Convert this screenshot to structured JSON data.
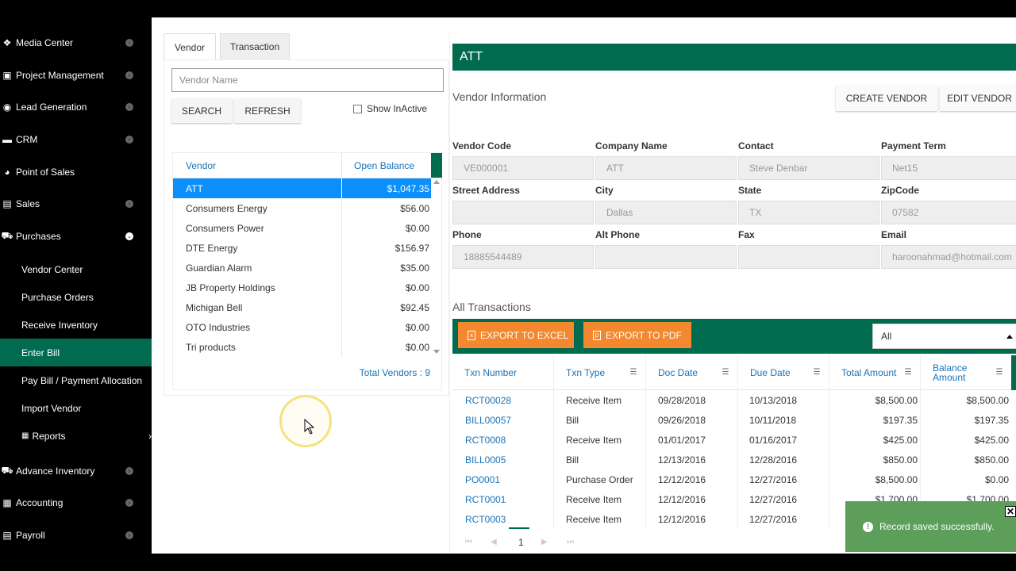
{
  "sidebar": {
    "items": [
      {
        "label": "Media Center",
        "icon": "cubes-icon"
      },
      {
        "label": "Project Management",
        "icon": "briefcase-icon"
      },
      {
        "label": "Lead Generation",
        "icon": "target-icon"
      },
      {
        "label": "CRM",
        "icon": "folder-icon"
      },
      {
        "label": "Point of Sales",
        "icon": "tachometer-icon"
      },
      {
        "label": "Sales",
        "icon": "money-icon"
      },
      {
        "label": "Purchases",
        "icon": "cart-icon"
      }
    ],
    "purchases_sub": [
      {
        "label": "Vendor Center"
      },
      {
        "label": "Purchase Orders"
      },
      {
        "label": "Receive Inventory"
      },
      {
        "label": "Enter Bill"
      },
      {
        "label": "Pay Bill / Payment Allocation"
      },
      {
        "label": "Import Vendor"
      },
      {
        "label": "Reports"
      }
    ],
    "bottom_items": [
      {
        "label": "Advance Inventory",
        "icon": "cart-icon"
      },
      {
        "label": "Accounting",
        "icon": "calculator-icon"
      },
      {
        "label": "Payroll",
        "icon": "money-icon"
      }
    ]
  },
  "left": {
    "tabs": [
      "Vendor",
      "Transaction"
    ],
    "search_placeholder": "Vendor Name",
    "search_label": "SEARCH",
    "refresh_label": "REFRESH",
    "show_inactive_label": "Show InActive",
    "grid": {
      "headers": [
        "Vendor",
        "Open Balance"
      ],
      "rows": [
        {
          "name": "ATT",
          "balance": "$1,047.35"
        },
        {
          "name": "Consumers Energy",
          "balance": "$56.00"
        },
        {
          "name": "Consumers Power",
          "balance": "$0.00"
        },
        {
          "name": "DTE Energy",
          "balance": "$156.97"
        },
        {
          "name": "Guardian Alarm",
          "balance": "$35.00"
        },
        {
          "name": "JB Property Holdings",
          "balance": "$0.00"
        },
        {
          "name": "Michigan Bell",
          "balance": "$92.45"
        },
        {
          "name": "OTO Industries",
          "balance": "$0.00"
        },
        {
          "name": "Tri products",
          "balance": "$0.00"
        }
      ],
      "total_label": "Total Vendors : 9"
    }
  },
  "right": {
    "title": "ATT",
    "vendor_info_label": "Vendor Information",
    "create_vendor_label": "CREATE VENDOR",
    "edit_vendor_label": "EDIT VENDOR",
    "fields": {
      "vendor_code_label": "Vendor Code",
      "vendor_code": "VE000001",
      "company_name_label": "Company Name",
      "company_name": "ATT",
      "contact_label": "Contact",
      "contact": "Steve Denbar",
      "payment_term_label": "Payment Term",
      "payment_term": "Net15",
      "street_label": "Street Address",
      "street": "",
      "city_label": "City",
      "city": "Dallas",
      "state_label": "State",
      "state": "TX",
      "zip_label": "ZipCode",
      "zip": "07582",
      "phone_label": "Phone",
      "phone": "18885544489",
      "alt_phone_label": "Alt Phone",
      "alt_phone": "",
      "fax_label": "Fax",
      "fax": "",
      "email_label": "Email",
      "email": "haroonahmad@hotmail.com"
    },
    "all_transactions_label": "All Transactions",
    "export_excel_label": "EXPORT TO EXCEL",
    "export_pdf_label": "EXPORT TO PDF",
    "filter_value": "All",
    "table": {
      "headers": [
        "Txn Number",
        "Txn Type",
        "Doc Date",
        "Due Date",
        "Total Amount",
        "Balance Amount"
      ],
      "rows": [
        [
          "RCT00028",
          "Receive Item",
          "09/28/2018",
          "10/13/2018",
          "$8,500.00",
          "$8,500.00"
        ],
        [
          "BILL00057",
          "Bill",
          "09/26/2018",
          "10/11/2018",
          "$197.35",
          "$197.35"
        ],
        [
          "RCT0008",
          "Receive Item",
          "01/01/2017",
          "01/16/2017",
          "$425.00",
          "$425.00"
        ],
        [
          "BILL0005",
          "Bill",
          "12/13/2016",
          "12/28/2016",
          "$850.00",
          "$850.00"
        ],
        [
          "PO0001",
          "Purchase Order",
          "12/12/2016",
          "12/27/2016",
          "$8,500.00",
          "$0.00"
        ],
        [
          "RCT0001",
          "Receive Item",
          "12/12/2016",
          "12/27/2016",
          "$1,700.00",
          "$1,700.00"
        ],
        [
          "RCT0003",
          "Receive Item",
          "12/12/2016",
          "12/27/2016",
          "",
          ""
        ]
      ]
    },
    "page": "1"
  },
  "toast": {
    "message": "Record saved successfully."
  }
}
